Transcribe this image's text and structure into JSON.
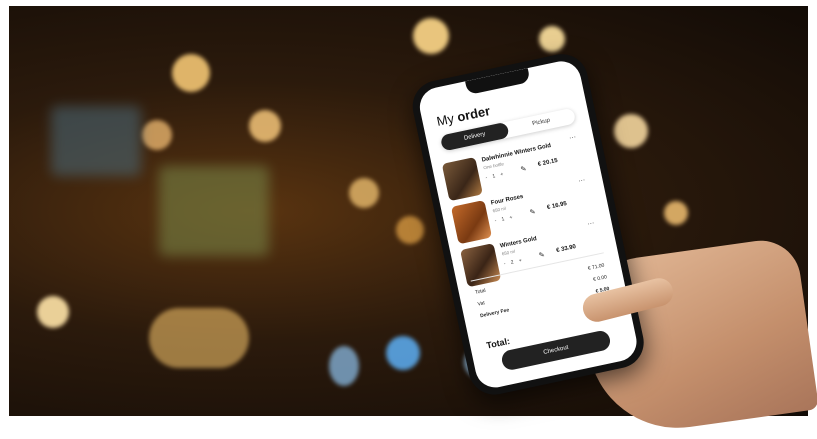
{
  "app": {
    "title_light": "My",
    "title_bold": "order",
    "tabs": [
      "Delivery",
      "Pickup"
    ]
  },
  "items": [
    {
      "name": "Dalwhinnie Winters Gold",
      "sub": "One bottle",
      "qty": "- 1 +",
      "price": "€ 20.15"
    },
    {
      "name": "Four Roses",
      "sub": "650 ml",
      "qty": "- 1 +",
      "price": "€ 16.95"
    },
    {
      "name": "Winters Gold",
      "sub": "650 ml",
      "qty": "- 2 +",
      "price": "€ 33.90"
    }
  ],
  "summary": {
    "total_label": "Total",
    "total_value": "€ 71.00",
    "vat_label": "Vat",
    "vat_value": "€ 0.00",
    "fee_label": "Delivery Fee",
    "fee_value": "€ 5.00",
    "grand_total_label": "Total:",
    "checkout_label": "Checkout"
  },
  "icons": {
    "edit": "pencil-icon",
    "more": "more-dots-icon"
  }
}
